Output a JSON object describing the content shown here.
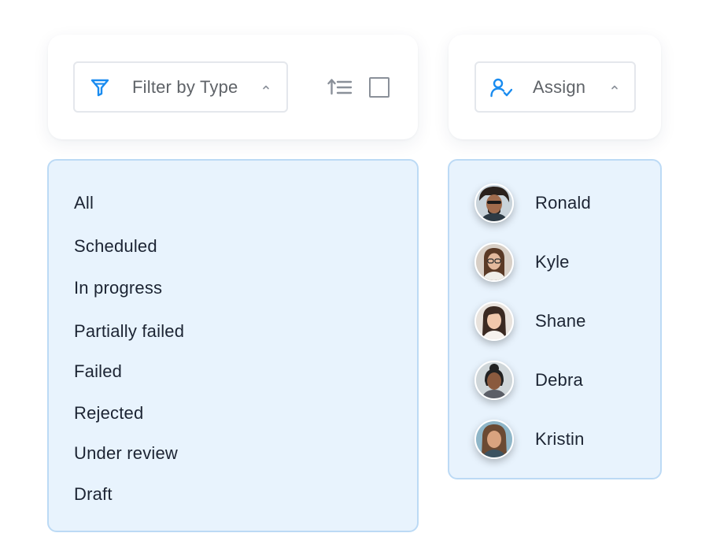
{
  "filter": {
    "label": "Filter by Type",
    "icon": "funnel-icon",
    "expanded": true,
    "options": [
      "All",
      "Scheduled",
      "In progress",
      "Partially failed",
      "Failed",
      "Rejected",
      "Under review",
      "Draft"
    ]
  },
  "toolbar": {
    "sort_icon": "sort-ascending-icon",
    "select_all_checked": false
  },
  "assign": {
    "label": "Assign",
    "icon": "user-check-icon",
    "expanded": true,
    "people": [
      "Ronald",
      "Kyle",
      "Shane",
      "Debra",
      "Kristin"
    ]
  },
  "colors": {
    "accent": "#1a8cf0",
    "menu_bg": "#e8f3fd",
    "menu_border": "#bcdaf5",
    "text": "#1c2433",
    "muted": "#5f6368"
  }
}
